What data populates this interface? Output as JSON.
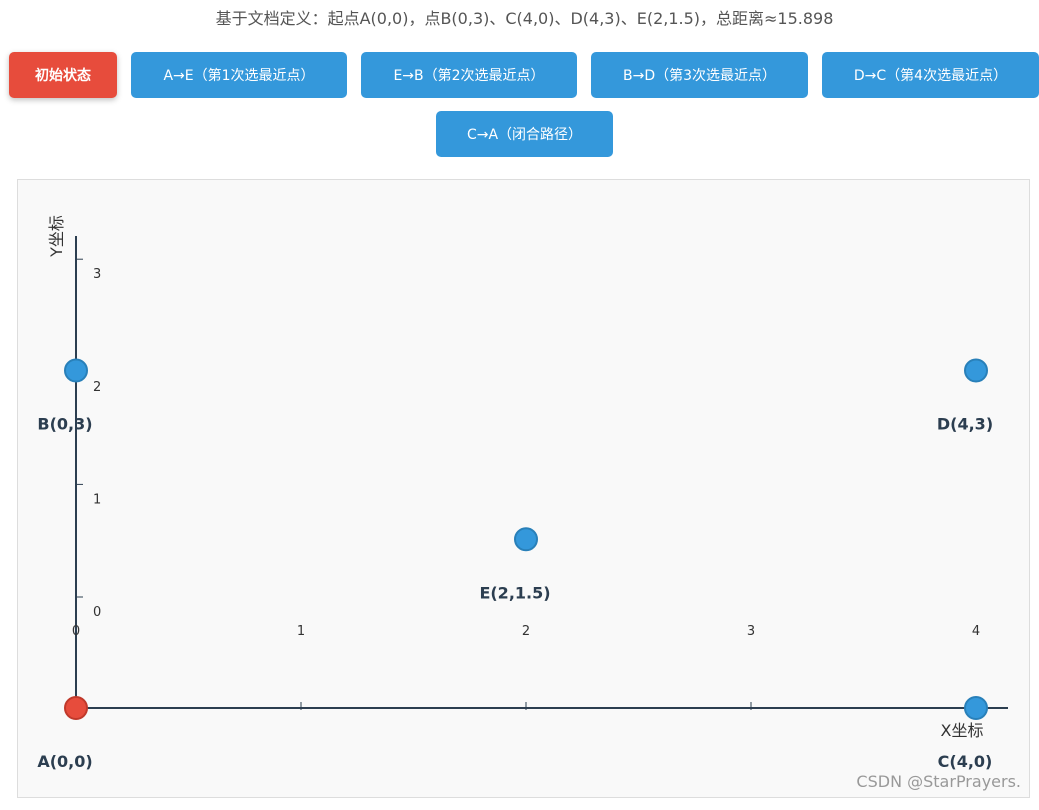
{
  "title": "基于文档定义：起点A(0,0)，点B(0,3)、C(4,0)、D(4,3)、E(2,1.5)，总距离≈15.898",
  "buttons": [
    {
      "label": "初始状态",
      "active": true
    },
    {
      "label": "A→E（第1次选最近点）",
      "active": false
    },
    {
      "label": "E→B（第2次选最近点）",
      "active": false
    },
    {
      "label": "B→D（第3次选最近点）",
      "active": false
    },
    {
      "label": "D→C（第4次选最近点）",
      "active": false
    },
    {
      "label": "C→A（闭合路径）",
      "active": false
    }
  ],
  "plot": {
    "x_axis_label": "X坐标",
    "y_axis_label": "Y坐标",
    "x_ticks": [
      "0",
      "1",
      "2",
      "3",
      "4"
    ],
    "y_ticks": [
      "0",
      "1",
      "2",
      "3"
    ],
    "points": [
      {
        "id": "A",
        "label": "A(0,0)",
        "x": 0,
        "y": 0,
        "color": "#e74c3c"
      },
      {
        "id": "B",
        "label": "B(0,3)",
        "x": 0,
        "y": 3,
        "color": "#3498db"
      },
      {
        "id": "C",
        "label": "C(4,0)",
        "x": 4,
        "y": 0,
        "color": "#3498db"
      },
      {
        "id": "D",
        "label": "D(4,3)",
        "x": 4,
        "y": 3,
        "color": "#3498db"
      },
      {
        "id": "E",
        "label": "E(2,1.5)",
        "x": 2,
        "y": 1.5,
        "color": "#3498db"
      }
    ]
  },
  "watermark": "CSDN @StarPrayers."
}
